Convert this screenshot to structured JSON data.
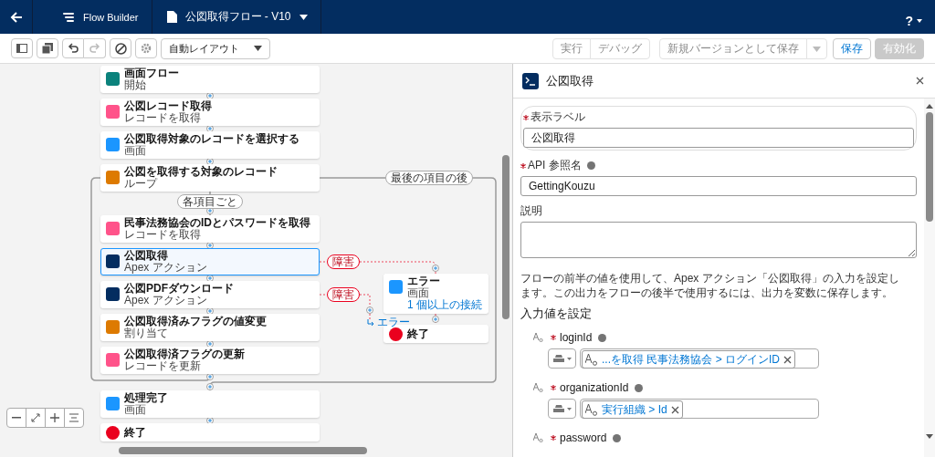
{
  "header": {
    "title": "Flow Builder",
    "flow_name": "公図取得フロー - V10",
    "help": "?"
  },
  "toolbar": {
    "layout_select": "自動レイアウト",
    "buttons": [
      {
        "label": "実行",
        "kind": "neutral",
        "disabled": true
      },
      {
        "label": "デバッグ",
        "kind": "neutral",
        "disabled": true
      },
      {
        "label": "新規バージョンとして保存",
        "kind": "split",
        "disabled": true
      },
      {
        "label": "保存",
        "kind": "neutral",
        "disabled": false
      },
      {
        "label": "有効化",
        "kind": "brand",
        "disabled": true
      }
    ]
  },
  "canvas": {
    "for_each_label": "各項目ごと",
    "after_last_label": "最後の項目の後",
    "nodes": [
      {
        "kind": "start",
        "title": "画面フロー",
        "subtitle": "開始",
        "selected": false
      },
      {
        "kind": "record_get",
        "title": "公図レコード取得",
        "subtitle": "レコードを取得",
        "selected": false
      },
      {
        "kind": "screen",
        "title": "公図取得対象のレコードを選択する",
        "subtitle": "画面",
        "selected": false
      },
      {
        "kind": "loop",
        "title": "公図を取得する対象のレコード",
        "subtitle": "ループ",
        "selected": false
      },
      {
        "kind": "record_get",
        "title": "民事法務協会のIDとパスワードを取得",
        "subtitle": "レコードを取得",
        "selected": false
      },
      {
        "kind": "apex",
        "title": "公図取得",
        "subtitle": "Apex アクション",
        "selected": true
      },
      {
        "kind": "apex",
        "title": "公図PDFダウンロード",
        "subtitle": "Apex アクション",
        "selected": false
      },
      {
        "kind": "assignment",
        "title": "公図取得済みフラグの値変更",
        "subtitle": "割り当て",
        "selected": false
      },
      {
        "kind": "record_update",
        "title": "公図取得済フラグの更新",
        "subtitle": "レコードを更新",
        "selected": false
      },
      {
        "kind": "screen",
        "title": "処理完了",
        "subtitle": "画面",
        "selected": false
      },
      {
        "kind": "end",
        "title": "終了",
        "selected": false
      }
    ],
    "fault_connectors": [
      {
        "label": "障害"
      },
      {
        "label": "障害",
        "goto": "エラー"
      }
    ],
    "fault_nodes": [
      {
        "kind": "screen",
        "title": "エラー",
        "subtitle": "画面",
        "link": "1 個以上の接続",
        "selected": false
      },
      {
        "kind": "end",
        "title": "終了",
        "selected": false
      }
    ]
  },
  "panel": {
    "title": "公図取得",
    "label_field": {
      "label": "表示ラベル",
      "required": true,
      "value": "公図取得"
    },
    "api_field": {
      "label": "API 参照名",
      "required": true,
      "value": "GettingKouzu"
    },
    "description_field": {
      "label": "説明",
      "required": false
    },
    "help_text": "フローの前半の値を使用して、Apex アクション「公図取得」の入力を設定します。この出力をフローの後半で使用するには、出力を変数に保存します。",
    "section_title": "入力値を設定",
    "inputs": [
      {
        "name": "loginId",
        "required": true,
        "value": "...を取得 民事法務協会 > ログインID"
      },
      {
        "name": "organizationId",
        "required": true,
        "value": "実行組織 > Id"
      },
      {
        "name": "password",
        "required": true
      }
    ]
  }
}
